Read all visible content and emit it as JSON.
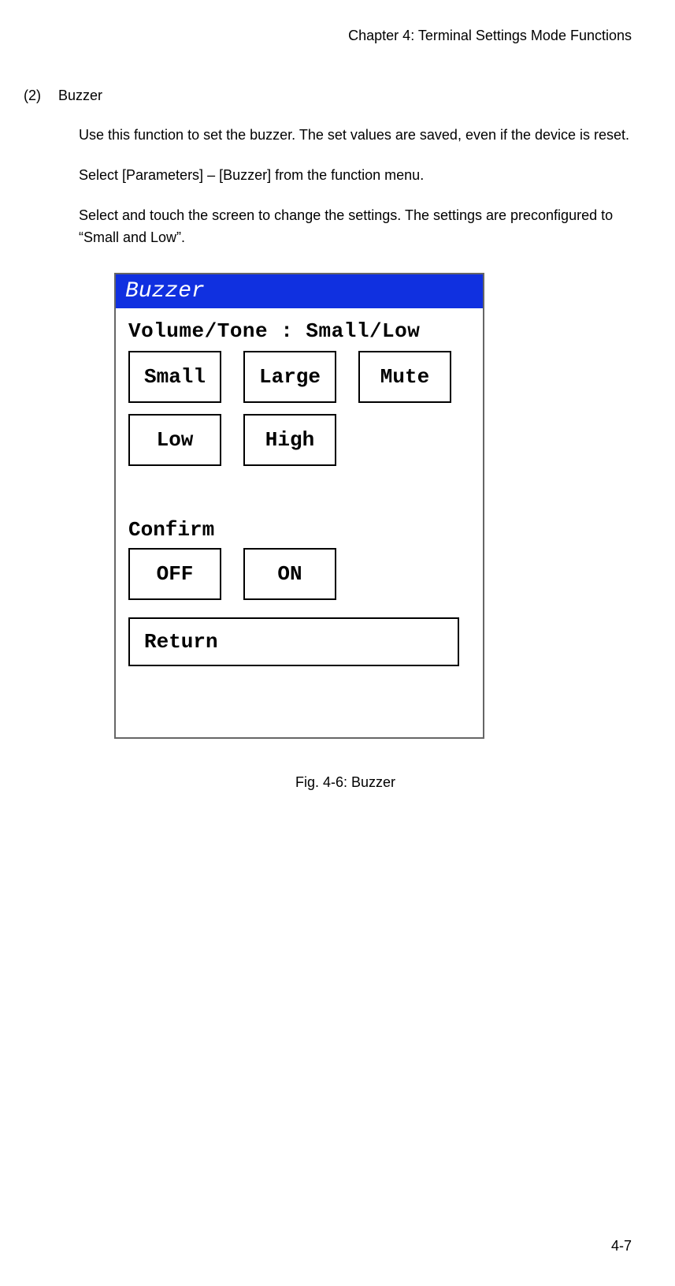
{
  "header": {
    "chapter": "Chapter 4: Terminal Settings Mode Functions"
  },
  "section": {
    "num": "(2)",
    "title": "Buzzer"
  },
  "paragraphs": {
    "p1": "Use this function to set the buzzer. The set values are saved, even if the device is reset.",
    "p2": "Select [Parameters] – [Buzzer] from the function menu.",
    "p3": "Select and touch the screen to change the settings. The settings are preconfigured to “Small and Low”."
  },
  "screen": {
    "panel_title": "Buzzer",
    "status": "Volume/Tone : Small/Low",
    "volume_buttons": [
      "Small",
      "Large",
      "Mute"
    ],
    "tone_buttons": [
      "Low",
      "High"
    ],
    "confirm_label": "Confirm",
    "confirm_buttons": [
      "OFF",
      "ON"
    ],
    "return_label": "Return"
  },
  "caption": "Fig. 4-6: Buzzer",
  "page_number": "4-7"
}
